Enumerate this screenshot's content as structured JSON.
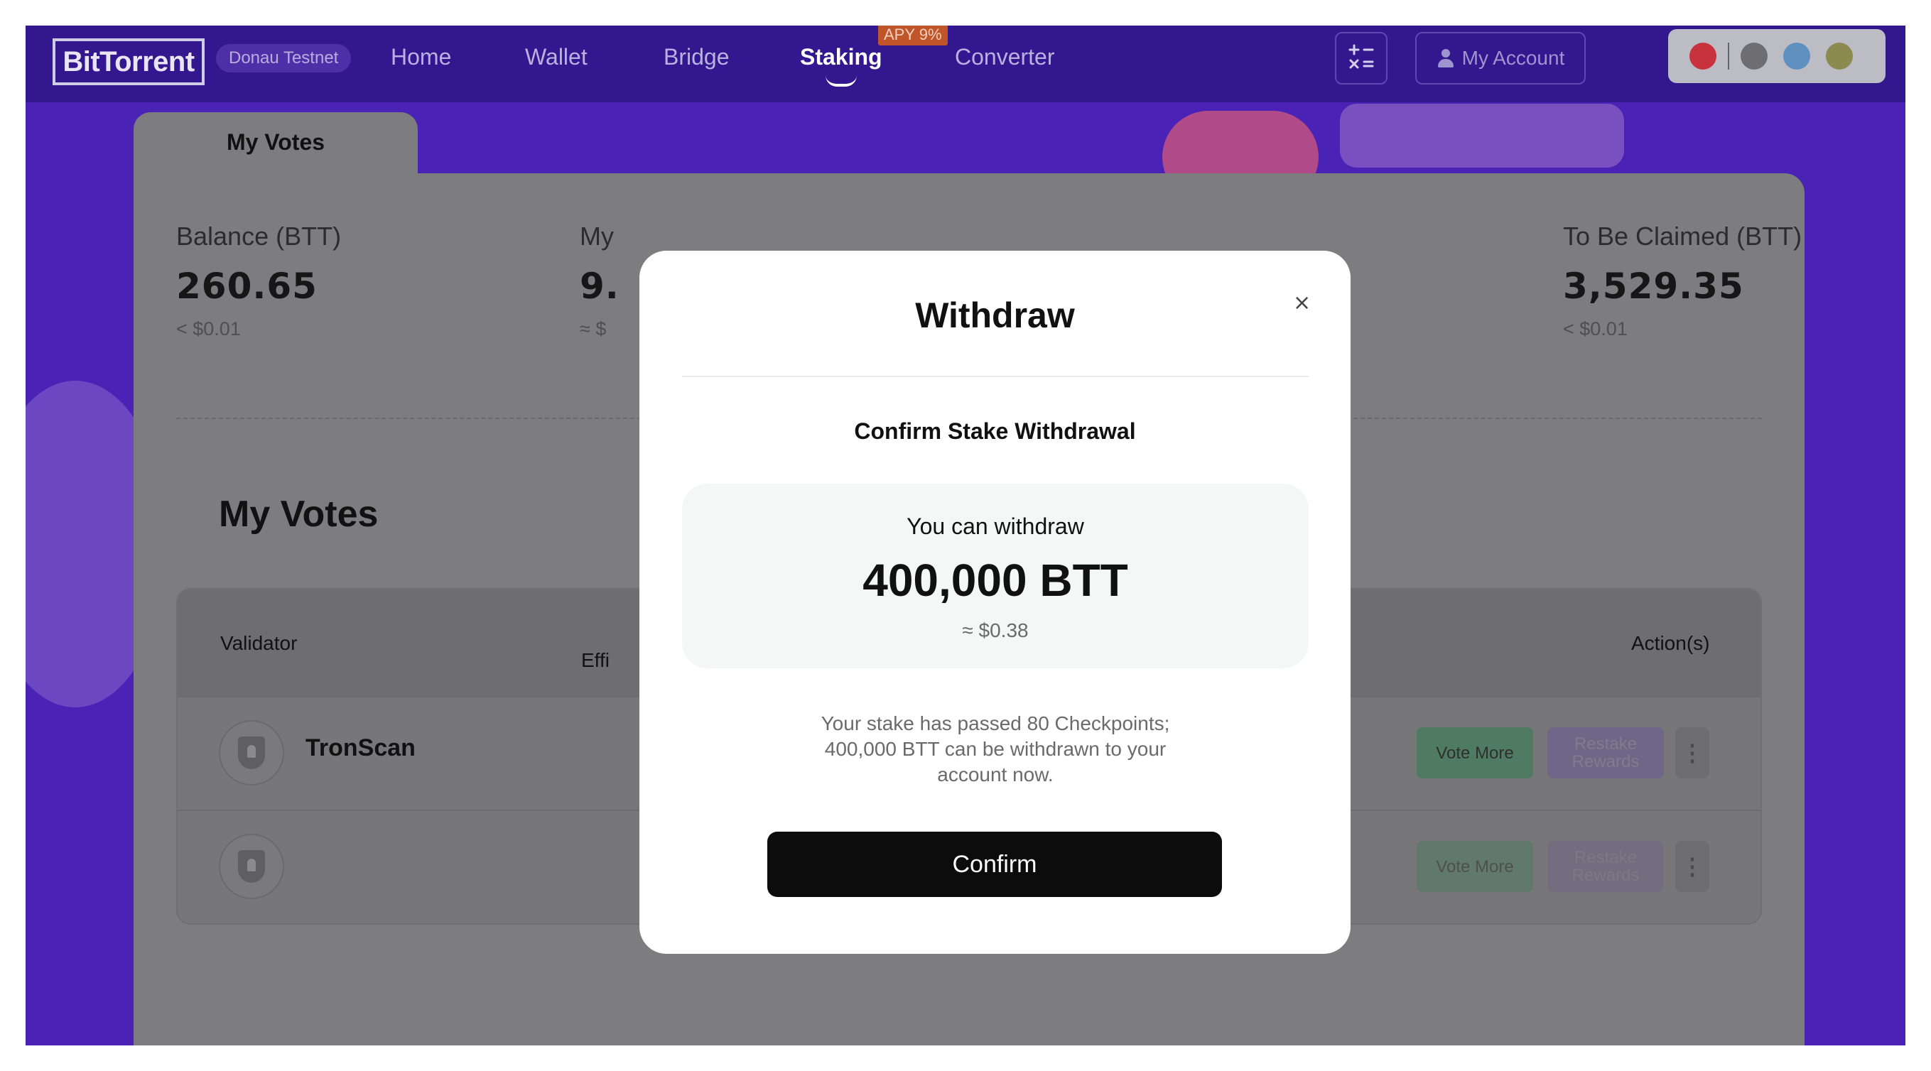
{
  "brand": {
    "logo": "BitTorrent",
    "network": "Donau Testnet"
  },
  "nav": {
    "links": [
      "Home",
      "Wallet",
      "Bridge",
      "Staking",
      "Converter"
    ],
    "active": "Staking",
    "staking_badge": "APY 9%",
    "account_label": "My Account"
  },
  "icons": {
    "calculator": "calculator-icon",
    "account": "person-icon",
    "wallets": [
      "wallet-icon-1",
      "wallet-icon-2",
      "wallet-icon-3",
      "wallet-icon-4"
    ]
  },
  "tab": {
    "label": "My Votes"
  },
  "stats": [
    {
      "label": "Balance (BTT)",
      "value": "260.65",
      "sub": "< $0.01"
    },
    {
      "label": "My",
      "value": "9.",
      "sub": "≈ $"
    },
    {
      "label": "To Be Claimed (BTT)",
      "value": "3,529.35",
      "sub": "< $0.01"
    }
  ],
  "votes": {
    "title": "My Votes",
    "headers": {
      "validator": "Validator",
      "effective": "Effi",
      "actions": "Action(s)"
    },
    "rows": [
      {
        "name": "TronScan",
        "vote_label": "Vote More",
        "restake_label": "Restake Rewards",
        "more": "⋮"
      },
      {
        "name": "",
        "vote_label": "Vote More",
        "restake_label": "Restake Rewards",
        "more": "⋮"
      }
    ]
  },
  "modal": {
    "title": "Withdraw",
    "close": "×",
    "subtitle": "Confirm Stake Withdrawal",
    "amount_label": "You can withdraw",
    "amount_value": "400,000 BTT",
    "amount_usd": "≈ $0.38",
    "note": "Your stake has passed 80 Checkpoints; 400,000 BTT can be withdrawn to your account now.",
    "confirm_label": "Confirm"
  },
  "colors": {
    "nav_bg": "#33178f",
    "app_bg": "#4a22b5",
    "confirm_bg": "#0c0c0c"
  }
}
